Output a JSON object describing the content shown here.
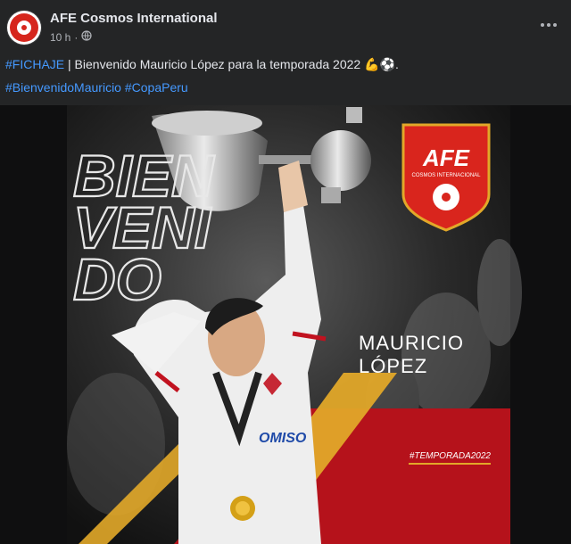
{
  "post": {
    "page_name": "AFE Cosmos International",
    "time": "10 h",
    "separator": "·",
    "more_label": "..."
  },
  "caption": {
    "hashtag_fichaje": "#FICHAJE",
    "sep": " | ",
    "text": "Bienvenido Mauricio López para la temporada 2022 ",
    "emoji_tail": "💪⚽.",
    "hashtag_bienvenido": "#BienvenidoMauricio",
    "space": " ",
    "hashtag_copa": "#CopaPeru"
  },
  "graphic": {
    "headline": [
      "BIEN",
      "VENI",
      "DO"
    ],
    "player_first": "MAURICIO",
    "player_last": "LÓPEZ",
    "season_tag": "#TEMPORADA2022",
    "logo_main": "AFE",
    "logo_sub": "COSMOS INTERNACIONAL"
  },
  "colors": {
    "bg": "#242526",
    "link": "#4599ff",
    "red": "#c1121f",
    "gold": "#e2a829"
  }
}
